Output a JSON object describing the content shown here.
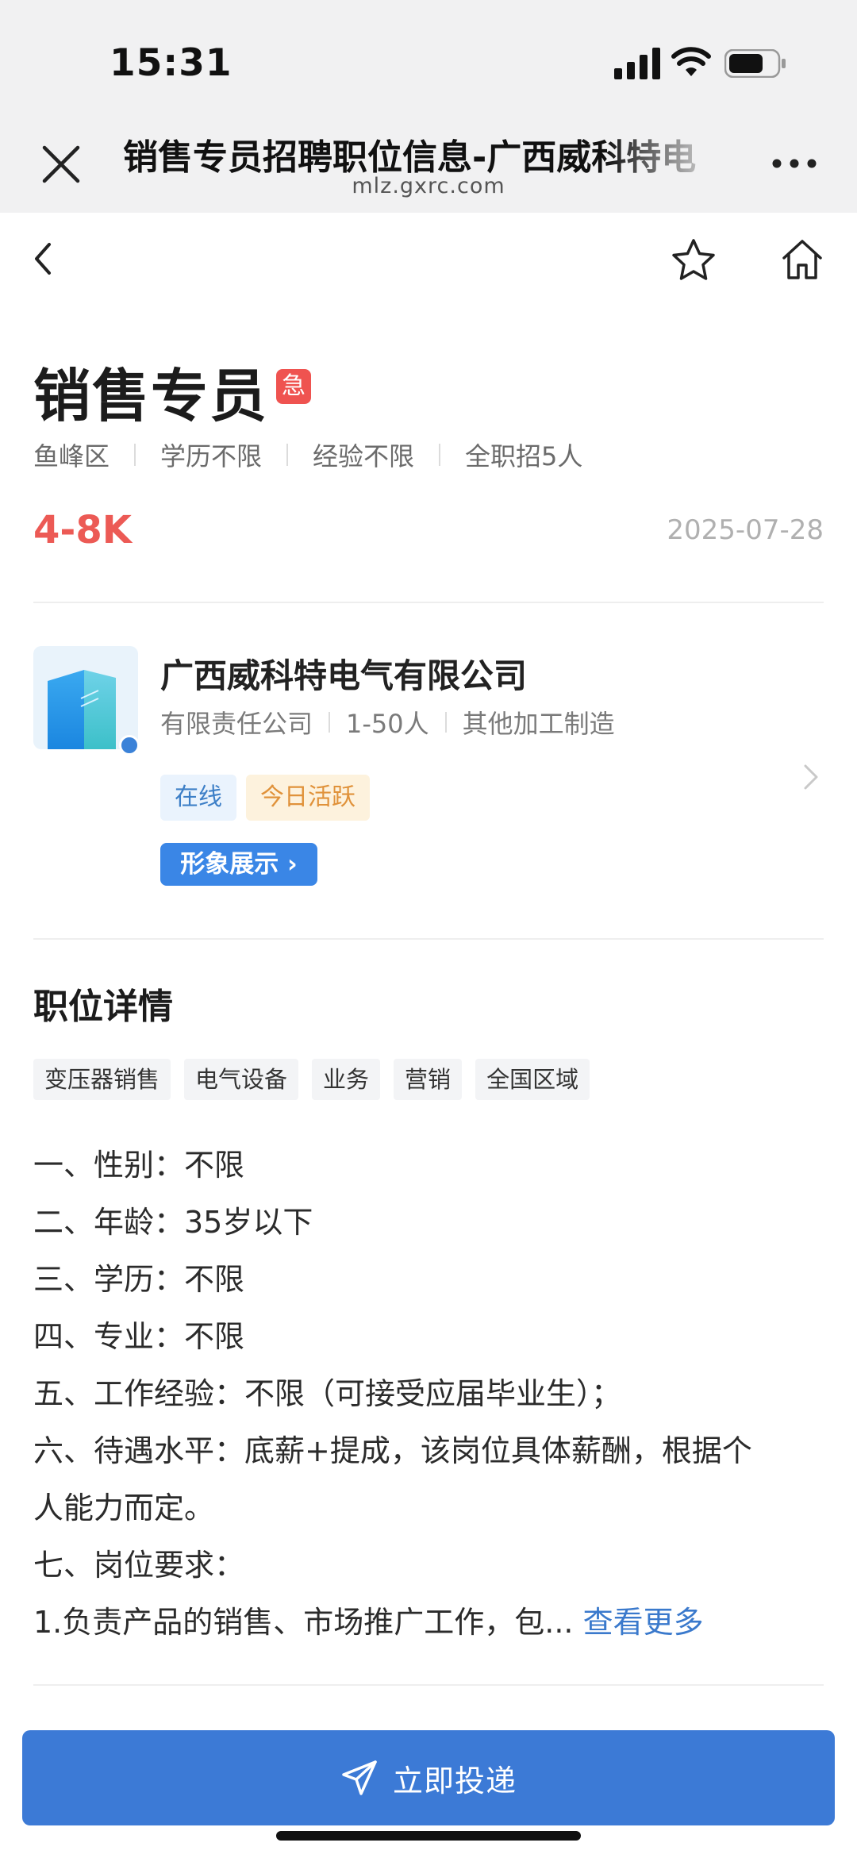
{
  "status_bar": {
    "time": "15:31"
  },
  "browser": {
    "title": "销售专员招聘职位信息-广西威科特电",
    "url": "mlz.gxrc.com"
  },
  "job": {
    "title": "销售专员",
    "urgent_badge": "急",
    "meta": [
      "鱼峰区",
      "学历不限",
      "经验不限",
      "全职招5人"
    ],
    "salary": "4-8K",
    "date": "2025-07-28"
  },
  "company": {
    "name": "广西威科特电气有限公司",
    "meta": [
      "有限责任公司",
      "1-50人",
      "其他加工制造"
    ],
    "badges": {
      "online": "在线",
      "active": "今日活跃"
    },
    "image_button": "形象展示 ›"
  },
  "details": {
    "section_title": "职位详情",
    "tags": [
      "变压器销售",
      "电气设备",
      "业务",
      "营销",
      "全国区域"
    ],
    "lines": [
      "一、性别：不限",
      "二、年龄：35岁以下",
      "三、学历：不限",
      "四、专业：不限",
      "五、工作经验：不限（可接受应届毕业生）；",
      "六、待遇水平：底薪+提成，该岗位具体薪酬，根据个",
      "人能力而定。",
      "七、岗位要求：",
      "1.负责产品的销售、市场推广工作，包..."
    ],
    "see_more": "查看更多"
  },
  "apply_button": "立即投递",
  "colors": {
    "salary": "#ec5a55",
    "primary": "#3c7ad6",
    "urgent": "#ef5350"
  }
}
